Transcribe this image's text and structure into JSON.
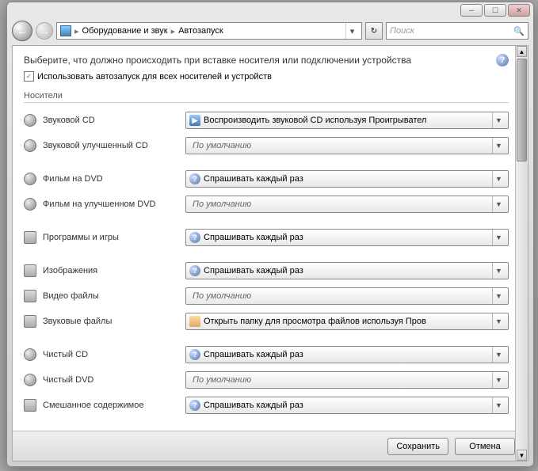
{
  "titlebar": {},
  "nav": {
    "crumb1": "Оборудование и звук",
    "crumb2": "Автозапуск",
    "search_placeholder": "Поиск"
  },
  "page": {
    "heading": "Выберите, что должно происходить при вставке носителя или подключении устройства",
    "checkbox_label": "Использовать автозапуск для всех носителей и устройств",
    "section_label": "Носители"
  },
  "rows": {
    "r0": {
      "label": "Звуковой CD",
      "value": "Воспроизводить звуковой CD используя Проигрывател"
    },
    "r1": {
      "label": "Звуковой улучшенный CD",
      "value": "По умолчанию"
    },
    "r2": {
      "label": "Фильм на DVD",
      "value": "Спрашивать каждый раз"
    },
    "r3": {
      "label": "Фильм на улучшенном DVD",
      "value": "По умолчанию"
    },
    "r4": {
      "label": "Программы и игры",
      "value": "Спрашивать каждый раз"
    },
    "r5": {
      "label": "Изображения",
      "value": "Спрашивать каждый раз"
    },
    "r6": {
      "label": "Видео файлы",
      "value": "По умолчанию"
    },
    "r7": {
      "label": "Звуковые файлы",
      "value": "Открыть папку для просмотра файлов используя Пров"
    },
    "r8": {
      "label": "Чистый CD",
      "value": "Спрашивать каждый раз"
    },
    "r9": {
      "label": "Чистый DVD",
      "value": "По умолчанию"
    },
    "r10": {
      "label": "Смешанное содержимое",
      "value": "Спрашивать каждый раз"
    }
  },
  "footer": {
    "save": "Сохранить",
    "cancel": "Отмена"
  }
}
